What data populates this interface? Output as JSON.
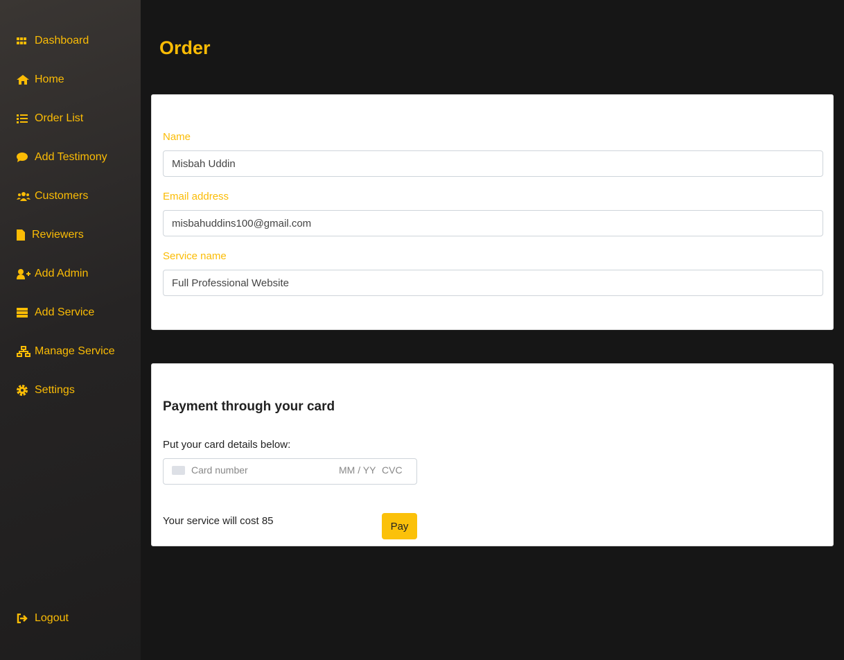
{
  "sidebar": {
    "items": [
      {
        "label": "Dashboard",
        "icon": "grid-icon"
      },
      {
        "label": "Home",
        "icon": "home-icon"
      },
      {
        "label": "Order List",
        "icon": "list-icon"
      },
      {
        "label": "Add Testimony",
        "icon": "comment-icon"
      },
      {
        "label": "Customers",
        "icon": "users-icon"
      },
      {
        "label": "Reviewers",
        "icon": "file-icon"
      },
      {
        "label": "Add Admin",
        "icon": "user-plus-icon"
      },
      {
        "label": "Add Service",
        "icon": "server-icon"
      },
      {
        "label": "Manage Service",
        "icon": "network-icon"
      },
      {
        "label": "Settings",
        "icon": "gear-icon"
      }
    ],
    "logout": "Logout"
  },
  "page": {
    "title": "Order"
  },
  "form": {
    "name_label": "Name",
    "name_value": "Misbah Uddin",
    "email_label": "Email address",
    "email_value": "misbahuddins100@gmail.com",
    "service_label": "Service name",
    "service_value": "Full Professional Website"
  },
  "payment": {
    "heading": "Payment through your card",
    "instruction": "Put your card details below:",
    "card_placeholder": "Card number",
    "expiry_placeholder": "MM / YY",
    "cvc_placeholder": "CVC",
    "cost_text": "Your service will cost 85",
    "pay_label": "Pay"
  },
  "colors": {
    "accent": "#fbbc05"
  }
}
